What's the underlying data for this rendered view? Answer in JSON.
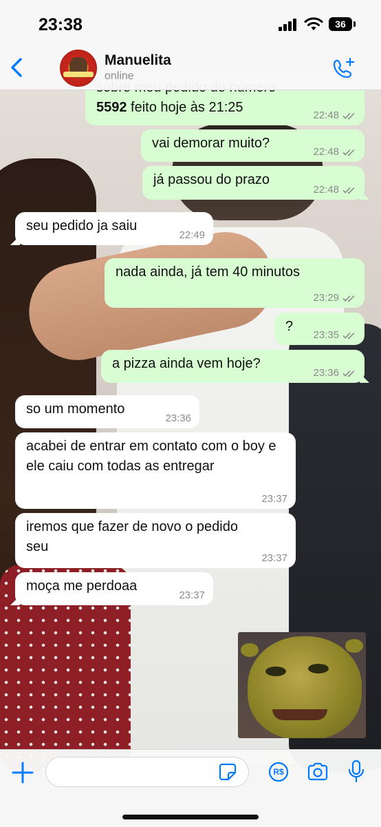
{
  "status_bar": {
    "time": "23:38",
    "battery": "36"
  },
  "header": {
    "contact_name": "Manuelita",
    "contact_status": "online"
  },
  "colors": {
    "accent": "#007aff",
    "outgoing_bubble": "#d9fdd3",
    "incoming_bubble": "#ffffff",
    "meta_text": "#8a8a8a"
  },
  "icons": [
    "back-chevron-icon",
    "add-call-icon",
    "plus-icon",
    "sticker-icon",
    "pix-payment-icon",
    "camera-icon",
    "microphone-icon",
    "read-ticks-icon"
  ],
  "messages": [
    {
      "direction": "out",
      "partial_first_line": "sobre meu pedido de número",
      "number": "5592",
      "text": " feito hoje às 21:25",
      "time": "22:48",
      "status": "read"
    },
    {
      "direction": "out",
      "text": "vai demorar muito?",
      "time": "22:48",
      "status": "read"
    },
    {
      "direction": "out",
      "text": "já passou do prazo",
      "time": "22:48",
      "status": "read"
    },
    {
      "direction": "in",
      "text": "seu pedido ja saiu",
      "time": "22:49"
    },
    {
      "direction": "out",
      "text": "nada ainda, já tem 40 minutos",
      "time": "23:29",
      "status": "read"
    },
    {
      "direction": "out",
      "text": "?",
      "time": "23:35",
      "status": "read"
    },
    {
      "direction": "out",
      "text": "a pizza ainda vem hoje?",
      "time": "23:36",
      "status": "read"
    },
    {
      "direction": "in",
      "text": "so um momento",
      "time": "23:36"
    },
    {
      "direction": "in",
      "text": "acabei de entrar em contato com o boy e ele caiu com todas as entregar",
      "time": "23:37"
    },
    {
      "direction": "in",
      "text": "iremos que fazer de novo o pedido seu",
      "time": "23:37"
    },
    {
      "direction": "in",
      "text": "moça me perdoaa",
      "time": "23:37"
    }
  ],
  "sticker": {
    "description_icon": "shrek-face-sticker"
  },
  "composer": {
    "placeholder": "",
    "pay_label": "R$"
  }
}
